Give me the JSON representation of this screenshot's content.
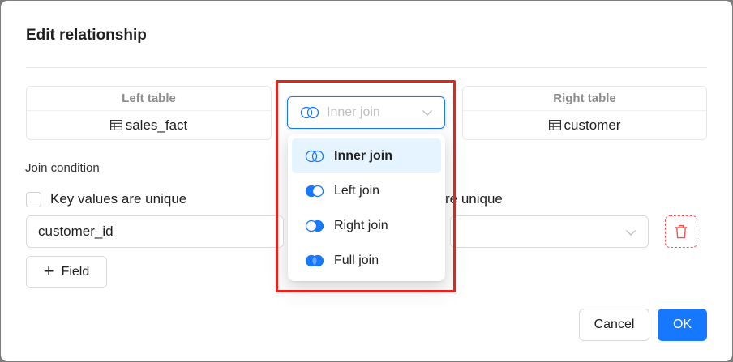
{
  "dialog": {
    "title": "Edit relationship"
  },
  "left_table": {
    "header": "Left table",
    "name": "sales_fact"
  },
  "right_table": {
    "header": "Right table",
    "name": "customer"
  },
  "join_select": {
    "placeholder": "Inner join",
    "options": [
      {
        "label": "Inner join",
        "selected": true,
        "icon": "inner-join-icon"
      },
      {
        "label": "Left join",
        "selected": false,
        "icon": "left-join-icon"
      },
      {
        "label": "Right join",
        "selected": false,
        "icon": "right-join-icon"
      },
      {
        "label": "Full join",
        "selected": false,
        "icon": "full-join-icon"
      }
    ]
  },
  "join_condition": {
    "label": "Join condition",
    "left_unique_label": "Key values are unique",
    "right_unique_label_visible": "re unique",
    "left_field_value": "customer_id",
    "add_field_label": "Field"
  },
  "footer": {
    "cancel_label": "Cancel",
    "ok_label": "OK"
  },
  "colors": {
    "primary": "#1677ff",
    "danger": "#ff4d4f",
    "highlight": "#e4231c",
    "selected_bg": "#e6f4ff"
  }
}
